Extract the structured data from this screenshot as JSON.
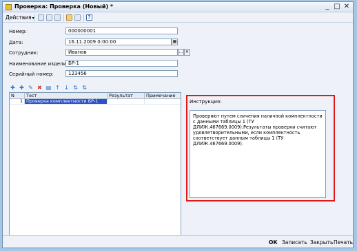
{
  "window": {
    "title": "Проверка: Проверка (Новый) *"
  },
  "toolbar": {
    "actions_label": "Действия"
  },
  "form": {
    "number": {
      "label": "Номер:",
      "value": "000000001"
    },
    "date": {
      "label": "Дата:",
      "value": "16.11.2009 0:00:00"
    },
    "employee": {
      "label": "Сотрудник:",
      "value": "Иванов"
    },
    "product_name": {
      "label": "Наименование изделия:",
      "value": "БР-1"
    },
    "serial_number": {
      "label": "Серийный номер:",
      "value": "123456"
    }
  },
  "grid": {
    "columns": [
      "N",
      "Тест",
      "Результат",
      "Примечание"
    ],
    "rows": [
      {
        "n": "1",
        "test": "Проверка комплектности БР-1",
        "result": "",
        "note": ""
      }
    ]
  },
  "instruction": {
    "label": "Инструкция:",
    "text": "Проверяют путем сличения наличной комплектности с данными таблицы 1 (ТУ ДЛИЖ.467669.0009).Результаты проверки считают удовлетворительными, если комплектность соответствует данным таблицы 1 (ТУ ДЛИЖ.467669.0009)."
  },
  "footer": {
    "ok_label": "ОК",
    "save_label": "Записать",
    "close_label": "Закрыть",
    "print_label": "Печать"
  },
  "colors": {
    "highlight_border": "#e01818",
    "selection": "#2f50c8"
  }
}
